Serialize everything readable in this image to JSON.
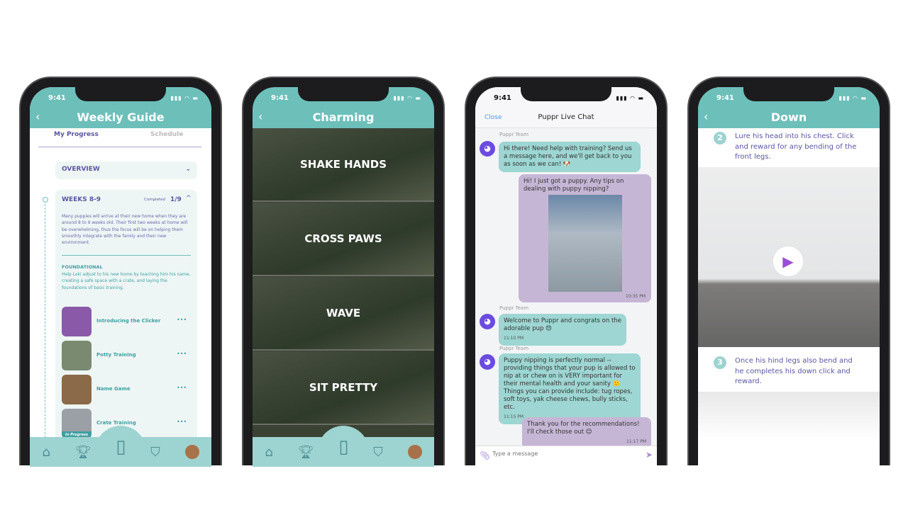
{
  "status_time": "9:41",
  "colors": {
    "teal": "#6dbfba",
    "nav": "#9dd3d0",
    "purple": "#5a56a0",
    "chat_team": "#9dd6d2",
    "chat_user": "#c6b6d6"
  },
  "guide": {
    "title": "Weekly Guide",
    "tabs": [
      "My Progress",
      "Schedule"
    ],
    "overview": "OVERVIEW",
    "week": {
      "title": "WEEKS 8-9",
      "completed_label": "Completed",
      "completed": "1/9",
      "description": "Many puppies will arrive at their new home when they are around 8 to 9 weeks old. Their first two weeks at home will be overwhelming, thus the focus will be on helping them smoothly integrate with the family and their new environment."
    },
    "section": {
      "title": "FOUNDATIONAL",
      "description": "Help Loki adjust to his new home by teaching him his name, creating a safe space with a crate, and laying the foundations of basic training."
    },
    "lessons": [
      {
        "title": "Introducing the Clicker"
      },
      {
        "title": "Potty Training"
      },
      {
        "title": "Name Game"
      },
      {
        "title": "Crate Training",
        "badge": "In Progress"
      }
    ],
    "more": "•••"
  },
  "tricks": {
    "title": "Charming",
    "items": [
      "SHAKE HANDS",
      "CROSS PAWS",
      "WAVE",
      "SIT PRETTY"
    ]
  },
  "chat": {
    "close": "Close",
    "title": "Puppr Live Chat",
    "sender": "Puppr Team",
    "messages": [
      {
        "text": "Hi there! Need help with training? Send us a message here, and we'll get back to you as soon as we can! 🐶",
        "time": ""
      },
      {
        "text": "Hi! I just got a puppy. Any tips on dealing with puppy nipping?",
        "time": "10:35 PM"
      },
      {
        "text": "Welcome to Puppr and congrats on the adorable pup 😍",
        "time": "11:10 PM"
      },
      {
        "text": "Puppy nipping is perfectly normal -- providing things that your pup is allowed to nip at or chew on is VERY important for their mental health and your sanity 🙂 Things you can provide include: tug ropes, soft toys, yak cheese chews, bully sticks, etc.",
        "time": "11:15 PM"
      },
      {
        "text": "Thank you for the recommendations! I'll check those out 😊",
        "time": "11:17 PM"
      }
    ],
    "placeholder": "Type a message"
  },
  "down": {
    "title": "Down",
    "steps": [
      {
        "num": "2",
        "text": "Lure his head into his chest. Click and reward for any bending of the front legs."
      },
      {
        "num": "3",
        "text": "Once his hind legs also bend and he completes his down click and reward."
      }
    ]
  }
}
